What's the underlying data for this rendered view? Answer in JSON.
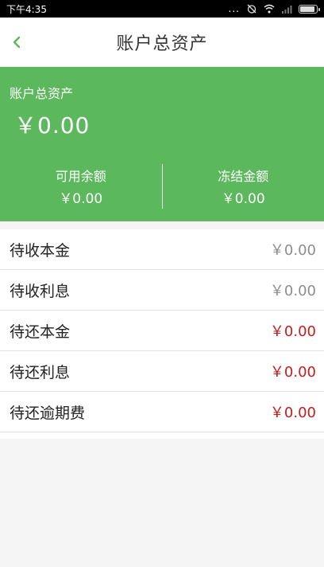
{
  "status_bar": {
    "time": "下午4:35",
    "dots": "..."
  },
  "header": {
    "title": "账户总资产"
  },
  "summary": {
    "label": "账户总资产",
    "total": "￥0.00",
    "available_label": "可用余额",
    "available_value": "￥0.00",
    "frozen_label": "冻结金额",
    "frozen_value": "￥0.00"
  },
  "items": [
    {
      "label": "待收本金",
      "value": "￥0.00"
    },
    {
      "label": "待收利息",
      "value": "￥0.00"
    },
    {
      "label": "待还本金",
      "value": "￥0.00"
    },
    {
      "label": "待还利息",
      "value": "￥0.00"
    },
    {
      "label": "待还逾期费",
      "value": "￥0.00"
    }
  ],
  "colors": {
    "accent_green": "#5cb85c",
    "value_gray": "#8d8d8d",
    "value_red": "#c51d1d"
  }
}
